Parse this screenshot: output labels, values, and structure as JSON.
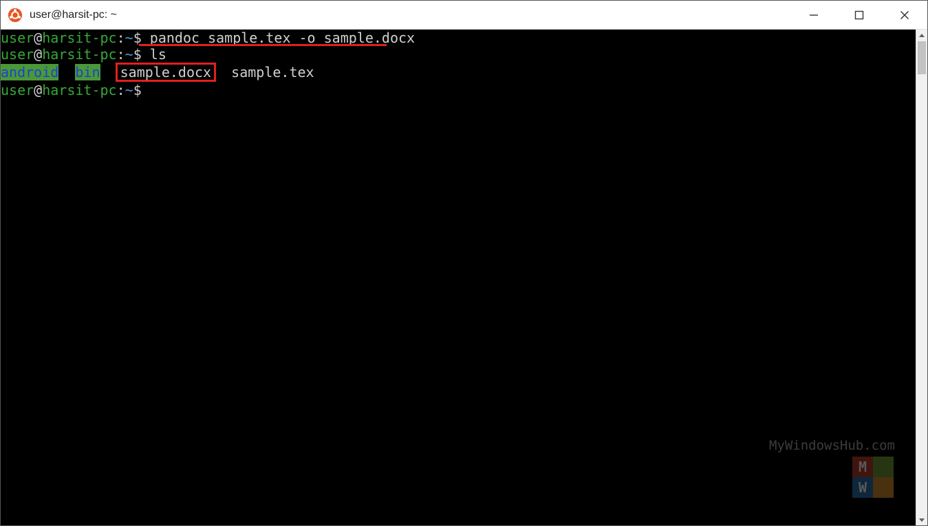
{
  "window": {
    "title": "user@harsit-pc: ~"
  },
  "prompt": {
    "user": "user",
    "at": "@",
    "host": "harsit-pc",
    "colon": ":",
    "cwd": "~",
    "dollar": "$"
  },
  "lines": {
    "cmd1": "pandoc sample.tex -o sample.docx",
    "cmd2": "ls",
    "ls": {
      "dir1": "android",
      "dir2": "bin",
      "file1": "sample.docx",
      "file2": "sample.tex"
    },
    "cmd3": ""
  },
  "watermark": {
    "text": "MyWindowsHub.com",
    "m": "M",
    "w": "W"
  }
}
